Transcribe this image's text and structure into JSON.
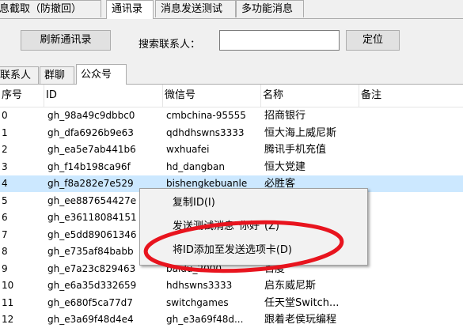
{
  "top_tabs": [
    "息截取（防撤回）",
    "通讯录",
    "消息发送测试",
    "多功能消息"
  ],
  "toolbar": {
    "refresh_label": "刷新通讯录",
    "search_label": "搜索联系人：",
    "search_value": "",
    "locate_label": "定位"
  },
  "sub_tabs": [
    "联系人",
    "群聊",
    "公众号"
  ],
  "table": {
    "columns": [
      "序号",
      "ID",
      "微信号",
      "名称",
      "备注"
    ],
    "rows": [
      {
        "idx": "0",
        "id": "gh_98a49c9dbbc0",
        "wxid": "cmbchina-95555",
        "name": "招商银行",
        "note": ""
      },
      {
        "idx": "1",
        "id": "gh_dfa6926b9e63",
        "wxid": "qdhdhswns3333",
        "name": "恒大海上威尼斯",
        "note": ""
      },
      {
        "idx": "2",
        "id": "gh_ea5e7ab441b6",
        "wxid": "wxhuafei",
        "name": "腾讯手机充值",
        "note": ""
      },
      {
        "idx": "3",
        "id": "gh_f14b198ca96f",
        "wxid": "hd_dangban",
        "name": "恒大党建",
        "note": ""
      },
      {
        "idx": "4",
        "id": "gh_f8a282e7e529",
        "wxid": "bishengkebuanle",
        "name": "必胜客",
        "note": ""
      },
      {
        "idx": "5",
        "id": "gh_ee887654427e",
        "wxid": "",
        "name": "",
        "note": ""
      },
      {
        "idx": "6",
        "id": "gh_e36118084151",
        "wxid": "",
        "name": "",
        "note": ""
      },
      {
        "idx": "7",
        "id": "gh_e5dd89061346",
        "wxid": "",
        "name": "",
        "note": ""
      },
      {
        "idx": "8",
        "id": "gh_e735af84babb",
        "wxid": "",
        "name": "",
        "note": ""
      },
      {
        "idx": "9",
        "id": "gh_e7a23c829463",
        "wxid": "baidu_2000",
        "name": "百度",
        "note": ""
      },
      {
        "idx": "10",
        "id": "gh_e6a35d332659",
        "wxid": "hdhswns3333",
        "name": "启东威尼斯",
        "note": ""
      },
      {
        "idx": "11",
        "id": "gh_e680f5ca77d7",
        "wxid": "switchgames",
        "name": "任天堂Switch...",
        "note": ""
      },
      {
        "idx": "12",
        "id": "gh_e3a69f48d4e4",
        "wxid": "gh_e3a69f48d...",
        "name": "跟着老侯玩编程",
        "note": ""
      }
    ]
  },
  "context_menu": {
    "items": [
      "复制ID(I)",
      "发送测试消息\"你好\"(Z)",
      "将ID添加至发送选项卡(D)"
    ]
  },
  "colors": {
    "selected_row": "#cce8ff",
    "annotation": "#e8141e"
  }
}
